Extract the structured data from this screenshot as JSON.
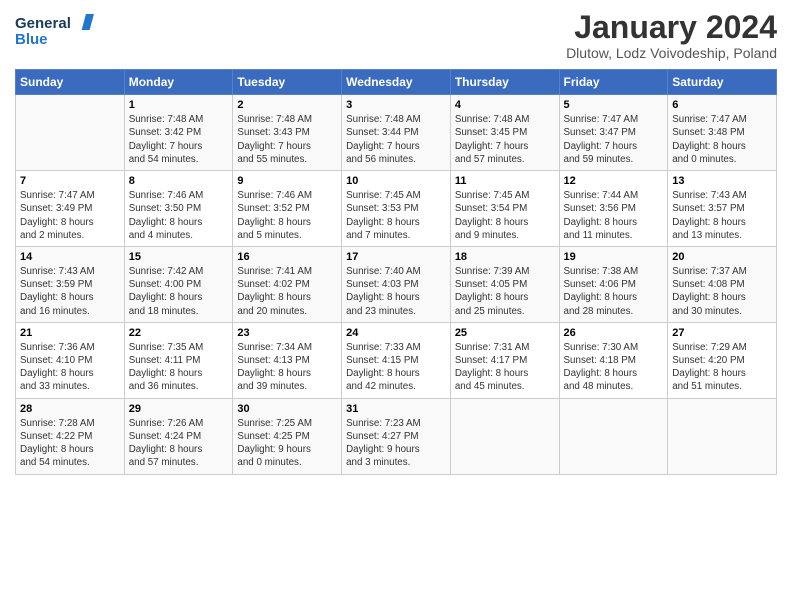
{
  "logo": {
    "line1": "General",
    "line2": "Blue"
  },
  "title": "January 2024",
  "subtitle": "Dlutow, Lodz Voivodeship, Poland",
  "days_of_week": [
    "Sunday",
    "Monday",
    "Tuesday",
    "Wednesday",
    "Thursday",
    "Friday",
    "Saturday"
  ],
  "weeks": [
    [
      {
        "day": "",
        "info": ""
      },
      {
        "day": "1",
        "info": "Sunrise: 7:48 AM\nSunset: 3:42 PM\nDaylight: 7 hours\nand 54 minutes."
      },
      {
        "day": "2",
        "info": "Sunrise: 7:48 AM\nSunset: 3:43 PM\nDaylight: 7 hours\nand 55 minutes."
      },
      {
        "day": "3",
        "info": "Sunrise: 7:48 AM\nSunset: 3:44 PM\nDaylight: 7 hours\nand 56 minutes."
      },
      {
        "day": "4",
        "info": "Sunrise: 7:48 AM\nSunset: 3:45 PM\nDaylight: 7 hours\nand 57 minutes."
      },
      {
        "day": "5",
        "info": "Sunrise: 7:47 AM\nSunset: 3:47 PM\nDaylight: 7 hours\nand 59 minutes."
      },
      {
        "day": "6",
        "info": "Sunrise: 7:47 AM\nSunset: 3:48 PM\nDaylight: 8 hours\nand 0 minutes."
      }
    ],
    [
      {
        "day": "7",
        "info": "Sunrise: 7:47 AM\nSunset: 3:49 PM\nDaylight: 8 hours\nand 2 minutes."
      },
      {
        "day": "8",
        "info": "Sunrise: 7:46 AM\nSunset: 3:50 PM\nDaylight: 8 hours\nand 4 minutes."
      },
      {
        "day": "9",
        "info": "Sunrise: 7:46 AM\nSunset: 3:52 PM\nDaylight: 8 hours\nand 5 minutes."
      },
      {
        "day": "10",
        "info": "Sunrise: 7:45 AM\nSunset: 3:53 PM\nDaylight: 8 hours\nand 7 minutes."
      },
      {
        "day": "11",
        "info": "Sunrise: 7:45 AM\nSunset: 3:54 PM\nDaylight: 8 hours\nand 9 minutes."
      },
      {
        "day": "12",
        "info": "Sunrise: 7:44 AM\nSunset: 3:56 PM\nDaylight: 8 hours\nand 11 minutes."
      },
      {
        "day": "13",
        "info": "Sunrise: 7:43 AM\nSunset: 3:57 PM\nDaylight: 8 hours\nand 13 minutes."
      }
    ],
    [
      {
        "day": "14",
        "info": "Sunrise: 7:43 AM\nSunset: 3:59 PM\nDaylight: 8 hours\nand 16 minutes."
      },
      {
        "day": "15",
        "info": "Sunrise: 7:42 AM\nSunset: 4:00 PM\nDaylight: 8 hours\nand 18 minutes."
      },
      {
        "day": "16",
        "info": "Sunrise: 7:41 AM\nSunset: 4:02 PM\nDaylight: 8 hours\nand 20 minutes."
      },
      {
        "day": "17",
        "info": "Sunrise: 7:40 AM\nSunset: 4:03 PM\nDaylight: 8 hours\nand 23 minutes."
      },
      {
        "day": "18",
        "info": "Sunrise: 7:39 AM\nSunset: 4:05 PM\nDaylight: 8 hours\nand 25 minutes."
      },
      {
        "day": "19",
        "info": "Sunrise: 7:38 AM\nSunset: 4:06 PM\nDaylight: 8 hours\nand 28 minutes."
      },
      {
        "day": "20",
        "info": "Sunrise: 7:37 AM\nSunset: 4:08 PM\nDaylight: 8 hours\nand 30 minutes."
      }
    ],
    [
      {
        "day": "21",
        "info": "Sunrise: 7:36 AM\nSunset: 4:10 PM\nDaylight: 8 hours\nand 33 minutes."
      },
      {
        "day": "22",
        "info": "Sunrise: 7:35 AM\nSunset: 4:11 PM\nDaylight: 8 hours\nand 36 minutes."
      },
      {
        "day": "23",
        "info": "Sunrise: 7:34 AM\nSunset: 4:13 PM\nDaylight: 8 hours\nand 39 minutes."
      },
      {
        "day": "24",
        "info": "Sunrise: 7:33 AM\nSunset: 4:15 PM\nDaylight: 8 hours\nand 42 minutes."
      },
      {
        "day": "25",
        "info": "Sunrise: 7:31 AM\nSunset: 4:17 PM\nDaylight: 8 hours\nand 45 minutes."
      },
      {
        "day": "26",
        "info": "Sunrise: 7:30 AM\nSunset: 4:18 PM\nDaylight: 8 hours\nand 48 minutes."
      },
      {
        "day": "27",
        "info": "Sunrise: 7:29 AM\nSunset: 4:20 PM\nDaylight: 8 hours\nand 51 minutes."
      }
    ],
    [
      {
        "day": "28",
        "info": "Sunrise: 7:28 AM\nSunset: 4:22 PM\nDaylight: 8 hours\nand 54 minutes."
      },
      {
        "day": "29",
        "info": "Sunrise: 7:26 AM\nSunset: 4:24 PM\nDaylight: 8 hours\nand 57 minutes."
      },
      {
        "day": "30",
        "info": "Sunrise: 7:25 AM\nSunset: 4:25 PM\nDaylight: 9 hours\nand 0 minutes."
      },
      {
        "day": "31",
        "info": "Sunrise: 7:23 AM\nSunset: 4:27 PM\nDaylight: 9 hours\nand 3 minutes."
      },
      {
        "day": "",
        "info": ""
      },
      {
        "day": "",
        "info": ""
      },
      {
        "day": "",
        "info": ""
      }
    ]
  ]
}
